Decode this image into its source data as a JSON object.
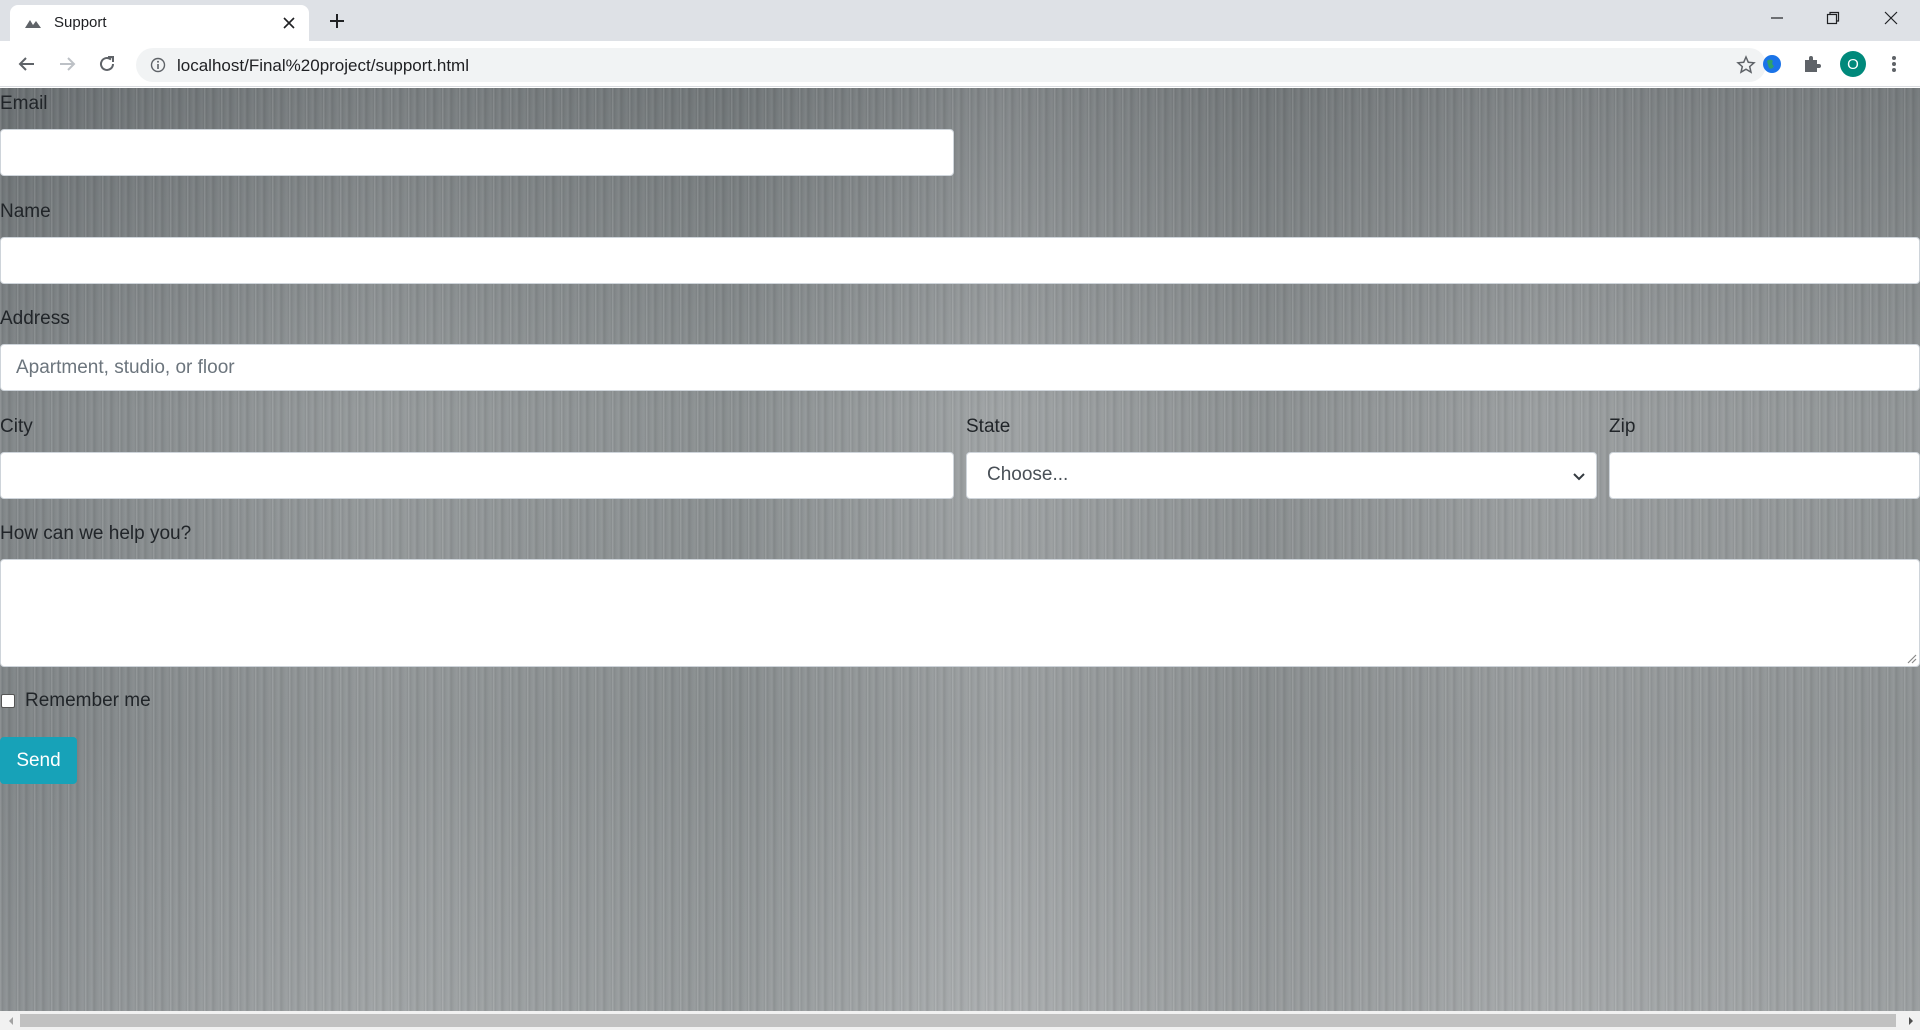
{
  "browser": {
    "tab_title": "Support",
    "url": "localhost/Final%20project/support.html",
    "profile_initial": "O",
    "icons": [
      "site-favicon",
      "close-icon",
      "plus-icon",
      "minimize-icon",
      "restore-icon",
      "close-window-icon",
      "back-arrow-icon",
      "forward-arrow-icon",
      "reload-icon",
      "info-icon",
      "star-icon",
      "globe-extension-icon",
      "puzzle-icon",
      "kebab-menu-icon"
    ]
  },
  "form": {
    "email_label": "Email",
    "email_value": "",
    "name_label": "Name",
    "name_value": "",
    "address_label": "Address",
    "address_placeholder": "Apartment, studio, or floor",
    "city_label": "City",
    "city_value": "",
    "state_label": "State",
    "state_selected": "Choose...",
    "zip_label": "Zip",
    "zip_value": "",
    "help_label": "How can we help you?",
    "help_value": "",
    "remember_label": "Remember me",
    "remember_checked": false,
    "send_label": "Send"
  },
  "colors": {
    "send_button": "#17a2b8",
    "profile_avatar": "#00897b"
  }
}
